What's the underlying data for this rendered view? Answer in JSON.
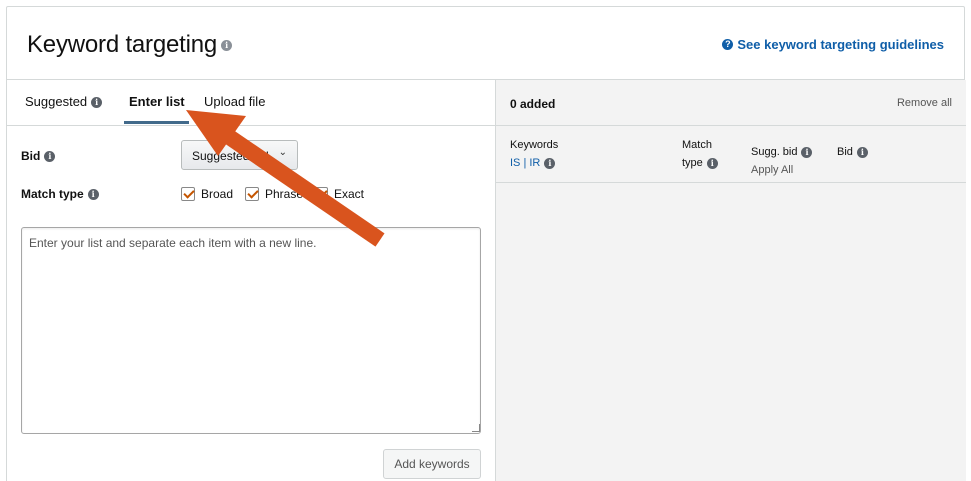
{
  "header": {
    "title": "Keyword targeting",
    "guidelines_link": "See keyword targeting guidelines"
  },
  "tabs": [
    {
      "label": "Suggested",
      "active": false
    },
    {
      "label": "Enter list",
      "active": true
    },
    {
      "label": "Upload file",
      "active": false
    }
  ],
  "form": {
    "bid_label": "Bid",
    "bid_dropdown": "Suggested bid",
    "match_type_label": "Match type",
    "match_types": [
      {
        "label": "Broad",
        "checked": true
      },
      {
        "label": "Phrase",
        "checked": true
      },
      {
        "label": "Exact",
        "checked": true
      }
    ],
    "textarea_placeholder": "Enter your list and separate each item with a new line.",
    "add_button": "Add keywords"
  },
  "added": {
    "count_label": "0 added",
    "remove_all": "Remove all",
    "columns": {
      "keywords": "Keywords",
      "is_ir": "IS | IR",
      "match": "Match",
      "type": "type",
      "sugg_bid": "Sugg. bid",
      "apply_all": "Apply All",
      "bid": "Bid"
    }
  },
  "colors": {
    "link": "#0f5ea8",
    "tab_underline": "#426a8b",
    "checkmark": "#c45500",
    "annotation_arrow": "#d9541e"
  }
}
